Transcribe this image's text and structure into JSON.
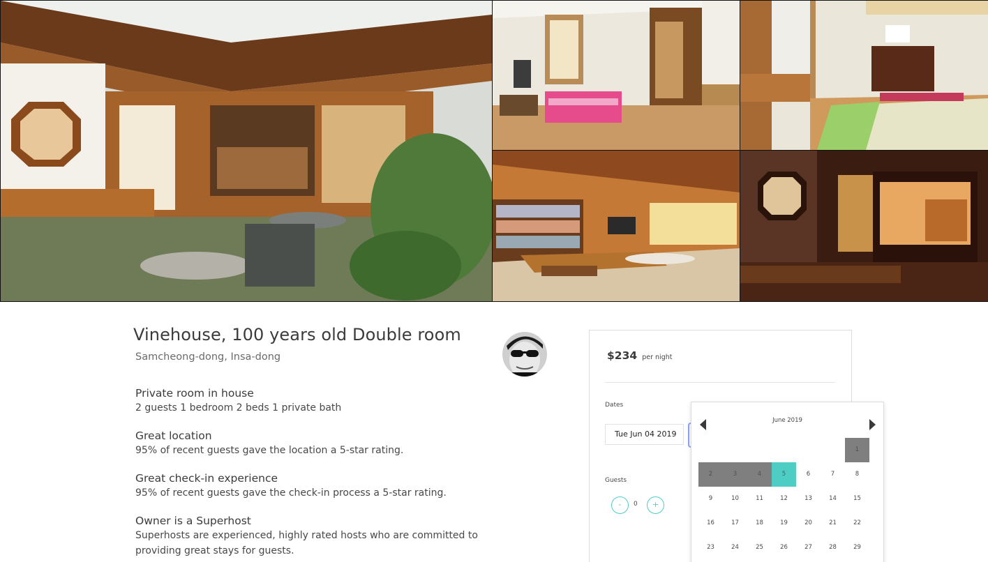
{
  "listing": {
    "title": "Vinehouse, 100 years old Double room",
    "location": "Samcheong-dong, Insa-dong"
  },
  "features": [
    {
      "heading": "Private room in house",
      "detail": "2 guests 1 bedroom 2 beds 1 private bath"
    },
    {
      "heading": "Great location",
      "detail": "95% of recent guests gave the location a 5-star rating."
    },
    {
      "heading": "Great check-in experience",
      "detail": "95% of recent guests gave the check-in process a 5-star rating."
    },
    {
      "heading": "Owner is a Superhost",
      "detail": "Superhosts are experienced, highly rated hosts who are committed to",
      "detail2": "providing great stays for guests."
    }
  ],
  "booking": {
    "price": "$234",
    "per_night": "per night",
    "dates_label": "Dates",
    "check_in_value": "Tue Jun 04 2019",
    "guests_label": "Guests",
    "guests_minus": "-",
    "guests_count": "0",
    "guests_plus": "+"
  },
  "calendar": {
    "month": "June 2019",
    "icons": {
      "prev": "caret-left-icon",
      "next": "caret-right-icon"
    },
    "selected_color": "#4ecdc4",
    "unavailable_color": "#7f7f7f",
    "days": [
      {
        "n": "1",
        "state": "past"
      },
      {
        "n": "2",
        "state": "past"
      },
      {
        "n": "3",
        "state": "past"
      },
      {
        "n": "4",
        "state": "past"
      },
      {
        "n": "5",
        "state": "selected"
      },
      {
        "n": "6",
        "state": "available"
      },
      {
        "n": "7",
        "state": "available"
      },
      {
        "n": "8",
        "state": "available"
      },
      {
        "n": "9",
        "state": "available"
      },
      {
        "n": "10",
        "state": "available"
      },
      {
        "n": "11",
        "state": "available"
      },
      {
        "n": "12",
        "state": "available"
      },
      {
        "n": "13",
        "state": "available"
      },
      {
        "n": "14",
        "state": "available"
      },
      {
        "n": "15",
        "state": "available"
      },
      {
        "n": "16",
        "state": "available"
      },
      {
        "n": "17",
        "state": "available"
      },
      {
        "n": "18",
        "state": "available"
      },
      {
        "n": "19",
        "state": "available"
      },
      {
        "n": "20",
        "state": "available"
      },
      {
        "n": "21",
        "state": "available"
      },
      {
        "n": "22",
        "state": "available"
      },
      {
        "n": "23",
        "state": "available"
      },
      {
        "n": "24",
        "state": "available"
      },
      {
        "n": "25",
        "state": "available"
      },
      {
        "n": "26",
        "state": "available"
      },
      {
        "n": "27",
        "state": "available"
      },
      {
        "n": "28",
        "state": "available"
      },
      {
        "n": "29",
        "state": "available"
      }
    ]
  },
  "gallery": {
    "photos": [
      "courtyard-photo",
      "bedroom-photo",
      "room-with-bedding-photo",
      "library-room-photo",
      "night-room-photo"
    ]
  }
}
